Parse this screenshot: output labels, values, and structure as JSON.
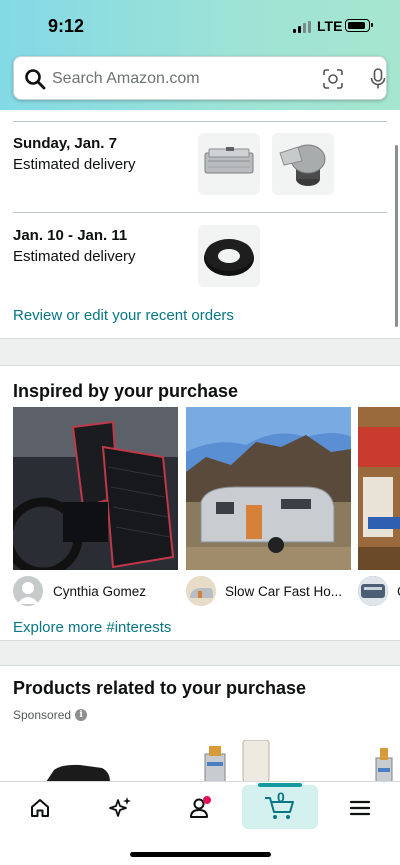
{
  "status_bar": {
    "time": "9:12",
    "network": "LTE"
  },
  "search": {
    "placeholder": "Search Amazon.com"
  },
  "deliveries": [
    {
      "date": "Sunday, Jan. 7",
      "label": "Estimated delivery"
    },
    {
      "date": "Jan. 10 - Jan. 11",
      "label": "Estimated delivery"
    }
  ],
  "review_link": "Review or edit your recent orders",
  "inspired": {
    "title": "Inspired by your purchase",
    "posts": [
      {
        "author": "Cynthia Gomez"
      },
      {
        "author": "Slow Car Fast Ho..."
      },
      {
        "author": "C"
      }
    ],
    "explore_link": "Explore more #interests"
  },
  "related": {
    "title": "Products related to your purchase",
    "sponsored_label": "Sponsored",
    "info_icon": "i"
  },
  "bottom_nav": {
    "items": [
      "home-icon",
      "sparkle-icon",
      "account-icon",
      "cart-icon",
      "menu-icon"
    ],
    "cart_count": "0",
    "accent": "#16999f",
    "notification_color": "#e3105a"
  },
  "colors": {
    "link": "#087783",
    "header_gradient_start": "#83d9e6",
    "header_gradient_end": "#a6e6cf"
  }
}
